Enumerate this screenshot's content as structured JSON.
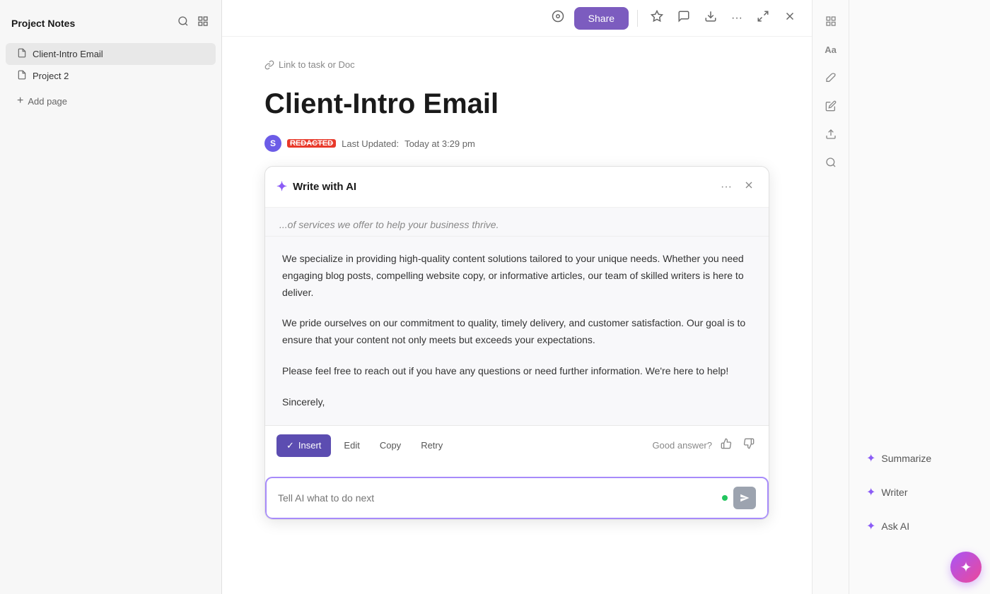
{
  "sidebar": {
    "title": "Project Notes",
    "search_icon": "🔍",
    "layout_icon": "⊞",
    "items": [
      {
        "label": "Client-Intro Email",
        "active": true
      },
      {
        "label": "Project 2",
        "active": false
      }
    ],
    "add_page_label": "Add page"
  },
  "topbar": {
    "tag_icon": "⊙",
    "share_label": "Share",
    "star_icon": "☆",
    "comment_icon": "💬",
    "download_icon": "⬇",
    "more_icon": "···",
    "expand_icon": "⤢",
    "close_icon": "✕"
  },
  "document": {
    "link_to_task_label": "Link to task or Doc",
    "title": "Client-Intro Email",
    "author_initial": "S",
    "author_name": "REDACTED",
    "last_updated_label": "Last Updated:",
    "last_updated_value": "Today at 3:29 pm"
  },
  "ai_panel": {
    "header_title": "Write with AI",
    "sparkle_icon": "✦",
    "more_icon": "···",
    "close_icon": "✕",
    "partial_text": "...of services we offer to help your business thrive.",
    "paragraphs": [
      "We specialize in providing high-quality content solutions tailored to your unique needs. Whether you need engaging blog posts, compelling website copy, or informative articles, our team of skilled writers is here to deliver.",
      "We pride ourselves on our commitment to quality, timely delivery, and customer satisfaction. Our goal is to ensure that your content not only meets but exceeds your expectations.",
      "Please feel free to reach out if you have any questions or need further information. We're here to help!",
      "Sincerely,"
    ],
    "footer": {
      "insert_label": "Insert",
      "insert_icon": "✓",
      "edit_label": "Edit",
      "copy_label": "Copy",
      "retry_label": "Retry",
      "good_answer_label": "Good answer?",
      "thumbs_up_icon": "👍",
      "thumbs_down_icon": "👎"
    },
    "input_placeholder": "Tell AI what to do next",
    "send_icon": "➤"
  },
  "right_tools": {
    "layout_icon": "⊞",
    "text_icon": "Aa",
    "paint_icon": "✏",
    "edit_icon": "✍",
    "upload_icon": "⬆",
    "search_icon": "🔍"
  },
  "far_right": {
    "buttons": [
      {
        "label": "Summarize",
        "sparkle": true
      },
      {
        "label": "Writer",
        "sparkle": true
      },
      {
        "label": "Ask AI",
        "sparkle": true
      }
    ],
    "fab_icon": "✦"
  }
}
